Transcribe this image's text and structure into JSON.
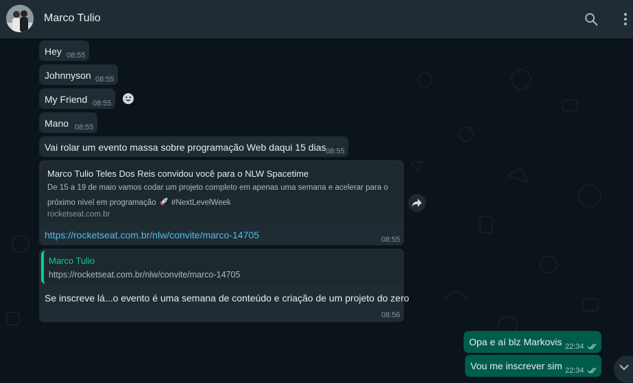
{
  "header": {
    "contact_name": "Marco Tulio",
    "search_icon": "search-icon",
    "menu_icon": "kebab-menu-icon"
  },
  "colors": {
    "header_bg": "#202c33",
    "chat_bg": "#0b141a",
    "incoming_bubble": "#202c33",
    "outgoing_bubble": "#005c4b",
    "link": "#53bdeb",
    "accent": "#06cf9c"
  },
  "messages": [
    {
      "text": "Hey",
      "time": "08:55"
    },
    {
      "text": "Johnnyson",
      "time": "08:55"
    },
    {
      "text": "My Friend",
      "time": "08:55"
    },
    {
      "text": "Mano",
      "time": "08:55"
    },
    {
      "text": "Vai rolar um evento massa sobre programação Web daqui 15 dias",
      "time": "08:55"
    }
  ],
  "link_message": {
    "preview_title": "Marco Tulio Teles Dos Reis convidou você para o NLW Spacetime",
    "preview_desc_line1": "De 15 a 19 de maio vamos codar um projeto completo em apenas uma semana e acelerar para o",
    "preview_desc_line2": "próximo nível em programação",
    "preview_hashtag": "#NextLevelWeek",
    "preview_domain": "rocketseat.com.br",
    "url": "https://rocketseat.com.br/nlw/convite/marco-14705",
    "time": "08:55"
  },
  "reply_message": {
    "quoted_author": "Marco Tulio",
    "quoted_text": "https://rocketseat.com.br/nlw/convite/marco-14705",
    "text": "Se inscreve lá...o evento é uma semana de conteúdo e criação de um projeto do zero",
    "time": "08:56"
  },
  "outgoing": [
    {
      "text": "Opa e aí blz Markovis",
      "time": "22:34"
    },
    {
      "text": "Vou me inscrever sim",
      "time": "22:34"
    }
  ]
}
